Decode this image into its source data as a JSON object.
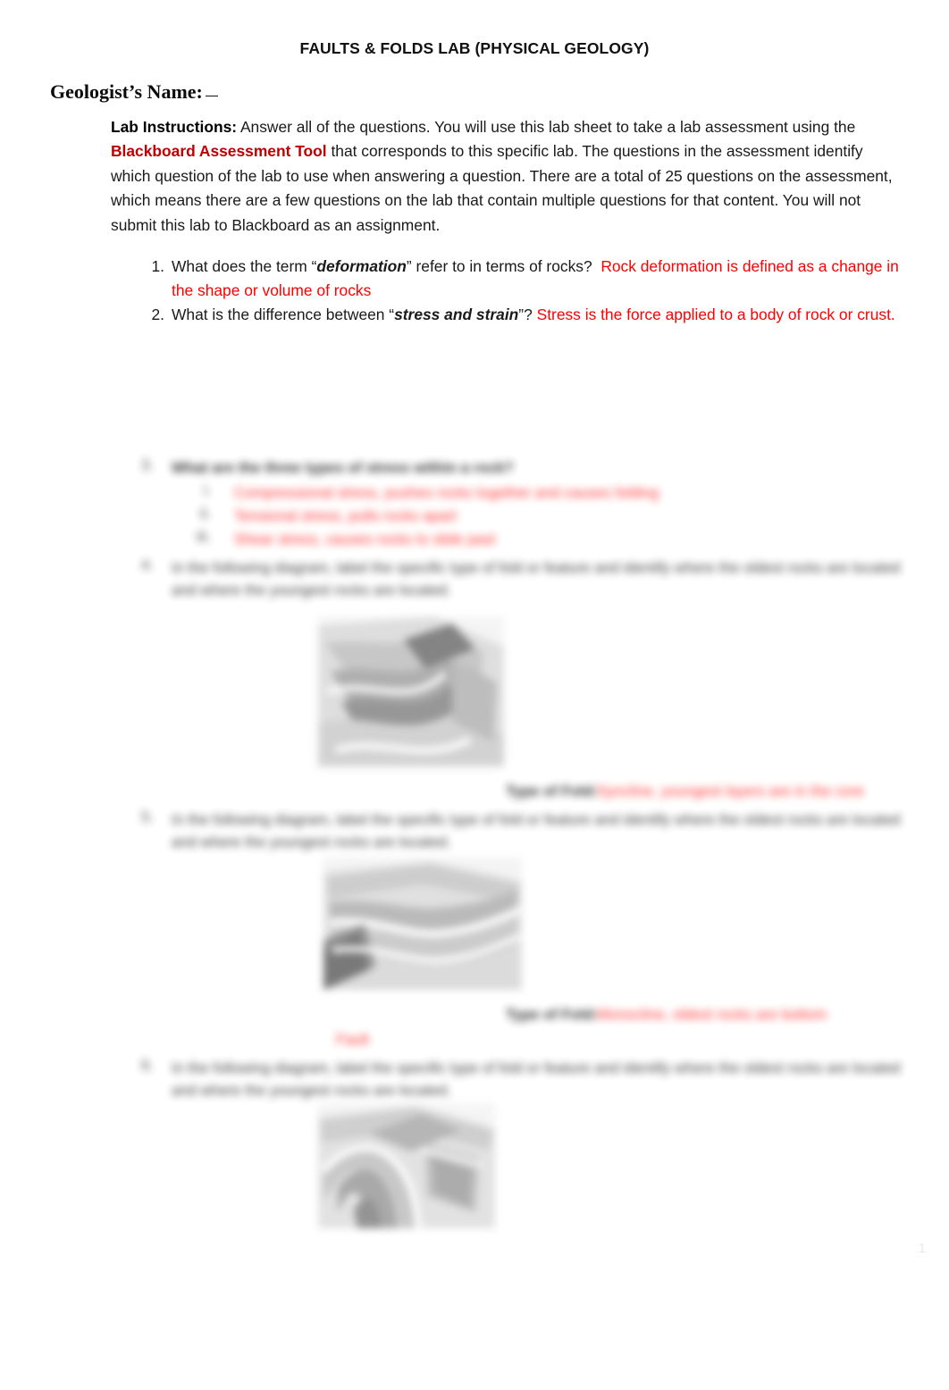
{
  "document": {
    "title": "FAULTS & FOLDS LAB (PHYSICAL GEOLOGY)",
    "page_number": "1"
  },
  "name_field": {
    "label": "Geologist’s Name:",
    "value": ""
  },
  "instructions": {
    "label": "Lab Instructions",
    "label_suffix": ":",
    "text_before_tool": "  Answer all of the questions.  You will use this lab sheet to take a lab assessment using the ",
    "tool_name": "Blackboard Assessment Tool",
    "text_after_tool": " that corresponds to this specific lab.  The questions in the assessment identify which question of the lab to use when answering a question. There are a total of 25 questions on the assessment, which means there are a few questions on the lab that contain multiple questions for that content. You will not submit this lab to Blackboard as an assignment."
  },
  "questions": [
    {
      "number": "1.",
      "text_before_term": "What does the term “",
      "term": "deformation",
      "text_after_term": "” refer to in terms of rocks?",
      "answer": "Rock deformation is defined as a change in the shape or volume of rocks"
    },
    {
      "number": "2.",
      "text_before_term": "What is the difference between “",
      "term": "stress and strain",
      "text_after_term": "”?",
      "answer": "Stress is the force applied to a body of rock or crust."
    }
  ],
  "blurred_section": {
    "note": "lower portion of page is out of focus / illegible",
    "question3": {
      "number": "3.",
      "prompt_placeholder": "What are the three types of stress within a rock?",
      "sub_items": [
        {
          "marker": "i.",
          "text_placeholder": "Compressional stress, pushes rocks together and causes folding"
        },
        {
          "marker": "ii.",
          "text_placeholder": "Tensional stress, pulls rocks apart"
        },
        {
          "marker": "iii.",
          "text_placeholder": "Shear stress, causes rocks to slide past"
        }
      ]
    },
    "question4": {
      "number": "4.",
      "prompt_placeholder": "In the following diagram, label the specific type of fold or feature and identify where the oldest rocks are located and where the youngest rocks are located.",
      "label_placeholder": "Type of Fold:",
      "answer_placeholder": "Syncline, youngest layers are in the core"
    },
    "question5": {
      "number": "5.",
      "prompt_placeholder": "In the following diagram, label the specific type of fold or feature and identify where the oldest rocks are located and where the youngest rocks are located.",
      "label_placeholder": "Type of Fold:",
      "answer_placeholder": "Monocline, oldest rocks are bottom",
      "extra_red_placeholder": "Fault"
    },
    "question6": {
      "number": "6.",
      "prompt_placeholder": "In the following diagram, label the specific type of fold or feature and identify where the oldest rocks are located and where the youngest rocks are located."
    },
    "diagrams": [
      {
        "name": "syncline-block-diagram"
      },
      {
        "name": "monocline-block-diagram"
      },
      {
        "name": "anticline-block-diagram"
      }
    ]
  },
  "colors": {
    "answer_red": "#FF0000",
    "tool_dark_red": "#C00000",
    "text": "#1a1a1a",
    "page_background": "#ffffff"
  }
}
